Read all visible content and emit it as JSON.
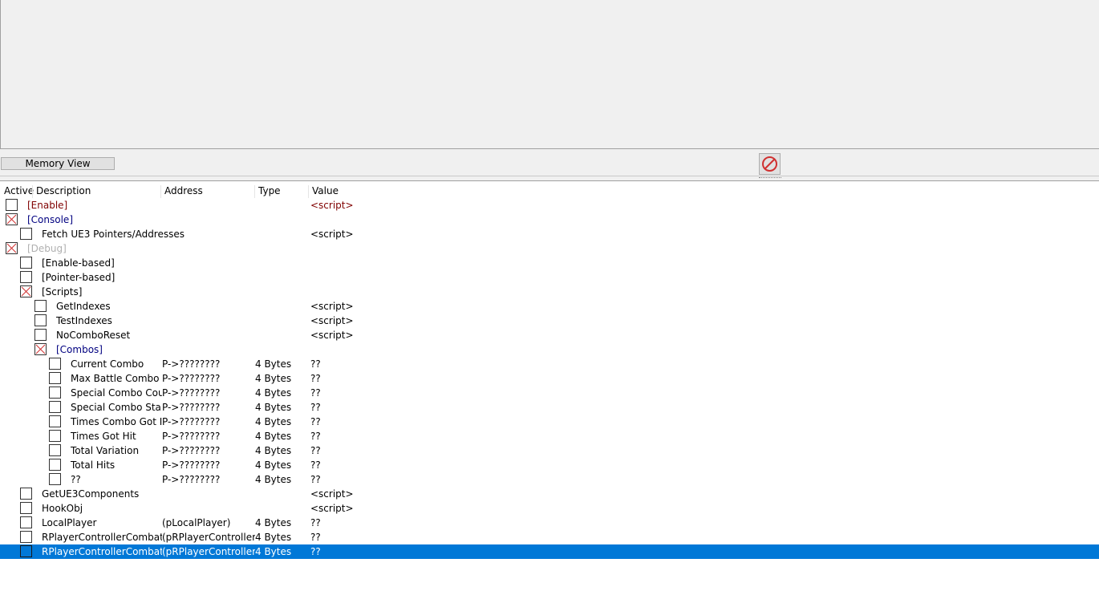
{
  "toolbar": {
    "memory_view_label": "Memory View"
  },
  "columns": {
    "active": "Active",
    "description": "Description",
    "address": "Address",
    "type": "Type",
    "value": "Value"
  },
  "rows": [
    {
      "description": "[Enable]",
      "address": "",
      "type": "",
      "value": "<script>",
      "checked": false,
      "level": 0,
      "style": "red"
    },
    {
      "description": "[Console]",
      "address": "",
      "type": "",
      "value": "",
      "checked": true,
      "level": 0,
      "style": "blue"
    },
    {
      "description": "Fetch UE3 Pointers/Addresses",
      "address": "",
      "type": "",
      "value": "<script>",
      "checked": false,
      "level": 1,
      "style": "normal"
    },
    {
      "description": "[Debug]",
      "address": "",
      "type": "",
      "value": "",
      "checked": true,
      "level": 0,
      "style": "gray"
    },
    {
      "description": "[Enable-based]",
      "address": "",
      "type": "",
      "value": "",
      "checked": false,
      "level": 1,
      "style": "normal"
    },
    {
      "description": "[Pointer-based]",
      "address": "",
      "type": "",
      "value": "",
      "checked": false,
      "level": 1,
      "style": "normal"
    },
    {
      "description": "[Scripts]",
      "address": "",
      "type": "",
      "value": "",
      "checked": true,
      "level": 1,
      "style": "normal"
    },
    {
      "description": "GetIndexes",
      "address": "",
      "type": "",
      "value": "<script>",
      "checked": false,
      "level": 2,
      "style": "normal"
    },
    {
      "description": "TestIndexes",
      "address": "",
      "type": "",
      "value": "<script>",
      "checked": false,
      "level": 2,
      "style": "normal"
    },
    {
      "description": "NoComboReset",
      "address": "",
      "type": "",
      "value": "<script>",
      "checked": false,
      "level": 2,
      "style": "normal"
    },
    {
      "description": "[Combos]",
      "address": "",
      "type": "",
      "value": "",
      "checked": true,
      "level": 2,
      "style": "blue"
    },
    {
      "description": "Current Combo",
      "address": "P->????????",
      "type": "4 Bytes",
      "value": "??",
      "checked": false,
      "level": 3,
      "style": "normal"
    },
    {
      "description": "Max Battle Combo",
      "address": "P->????????",
      "type": "4 Bytes",
      "value": "??",
      "checked": false,
      "level": 3,
      "style": "normal"
    },
    {
      "description": "Special Combo Count",
      "address": "P->????????",
      "type": "4 Bytes",
      "value": "??",
      "checked": false,
      "level": 3,
      "style": "normal"
    },
    {
      "description": "Special Combo Star(s)",
      "address": "P->????????",
      "type": "4 Bytes",
      "value": "??",
      "checked": false,
      "level": 3,
      "style": "normal"
    },
    {
      "description": "Times Combo Got Int",
      "address": "P->????????",
      "type": "4 Bytes",
      "value": "??",
      "checked": false,
      "level": 3,
      "style": "normal"
    },
    {
      "description": "Times Got Hit",
      "address": "P->????????",
      "type": "4 Bytes",
      "value": "??",
      "checked": false,
      "level": 3,
      "style": "normal"
    },
    {
      "description": "Total Variation",
      "address": "P->????????",
      "type": "4 Bytes",
      "value": "??",
      "checked": false,
      "level": 3,
      "style": "normal"
    },
    {
      "description": "Total Hits",
      "address": "P->????????",
      "type": "4 Bytes",
      "value": "??",
      "checked": false,
      "level": 3,
      "style": "normal"
    },
    {
      "description": "??",
      "address": "P->????????",
      "type": "4 Bytes",
      "value": "??",
      "checked": false,
      "level": 3,
      "style": "normal"
    },
    {
      "description": "GetUE3Components",
      "address": "",
      "type": "",
      "value": "<script>",
      "checked": false,
      "level": 1,
      "style": "normal"
    },
    {
      "description": "HookObj",
      "address": "",
      "type": "",
      "value": "<script>",
      "checked": false,
      "level": 1,
      "style": "normal"
    },
    {
      "description": "LocalPlayer",
      "address": "(pLocalPlayer)",
      "type": "4 Bytes",
      "value": "??",
      "checked": false,
      "level": 1,
      "style": "normal"
    },
    {
      "description": "RPlayerControllerCombat",
      "address": "(pRPlayerControllerCo",
      "type": "4 Bytes",
      "value": "??",
      "checked": false,
      "level": 1,
      "style": "normal"
    },
    {
      "description": "RPlayerControllerCombat_a",
      "address": "(pRPlayerControllerCo",
      "type": "4 Bytes",
      "value": "??",
      "checked": false,
      "level": 1,
      "style": "normal",
      "selected": true
    }
  ],
  "colors": {
    "selection": "#0078d7",
    "script_red": "#800000",
    "group_blue": "#000080",
    "disabled_gray": "#b0b0b0",
    "clear_icon": "#d03030"
  },
  "icons": {
    "clear": "no-entry-icon",
    "check": "x-mark-icon"
  }
}
